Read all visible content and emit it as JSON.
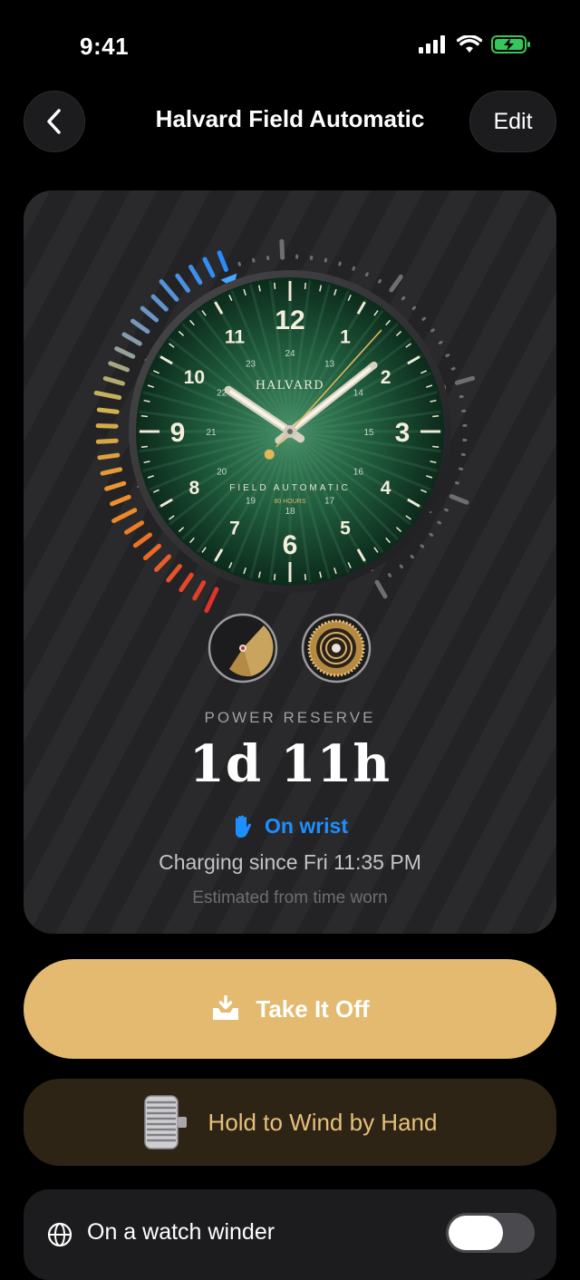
{
  "status": {
    "time": "9:41"
  },
  "nav": {
    "title": "Halvard Field Automatic",
    "edit_label": "Edit"
  },
  "dial": {
    "brand": "HALVARD",
    "model": "FIELD AUTOMATIC",
    "reserve_badge": "80 HOURS",
    "hour_numerals": [
      "12",
      "1",
      "2",
      "3",
      "4",
      "5",
      "6",
      "7",
      "8",
      "9",
      "10",
      "11"
    ],
    "inner_numerals": [
      "24",
      "13",
      "14",
      "15",
      "16",
      "17",
      "18",
      "19",
      "20",
      "21",
      "22",
      "23"
    ],
    "hand_time": "10:08:37"
  },
  "gauge": {
    "ticks": [
      "0",
      "12",
      "24",
      "36",
      "48",
      "60",
      "72",
      "80"
    ],
    "max_hours": 80,
    "current_hours": 35
  },
  "power_reserve": {
    "label": "POWER RESERVE",
    "value": "1d 11h",
    "state": "On wrist",
    "charging": "Charging since Fri 11:35 PM",
    "note": "Estimated from time worn"
  },
  "actions": {
    "take_off": "Take It Off",
    "wind": "Hold to Wind by Hand",
    "winder_label": "On a watch winder",
    "winder_on": false
  },
  "colors": {
    "accent_blue": "#1e8fff",
    "gold": "#e3ba6f",
    "dial_green": "#1f5a3c"
  }
}
